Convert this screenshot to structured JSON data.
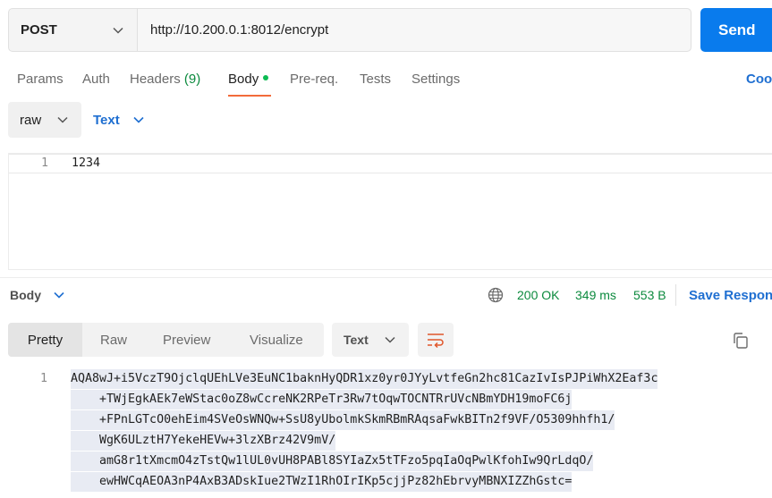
{
  "request": {
    "method": "POST",
    "url": "http://10.200.0.1:8012/encrypt",
    "send_label": "Send"
  },
  "tabs": [
    {
      "label": "Params"
    },
    {
      "label": "Auth"
    },
    {
      "label": "Headers",
      "count": "(9)"
    },
    {
      "label": "Body",
      "active": true
    },
    {
      "label": "Pre-req."
    },
    {
      "label": "Tests"
    },
    {
      "label": "Settings"
    }
  ],
  "cookies_label": "Coo",
  "body_options": {
    "mode": "raw",
    "language": "Text"
  },
  "request_body": {
    "line_number": "1",
    "text": "1234"
  },
  "response": {
    "section_label": "Body",
    "status": "200 OK",
    "time": "349 ms",
    "size": "553 B",
    "save_label": "Save Respon",
    "view_tabs": [
      "Pretty",
      "Raw",
      "Preview",
      "Visualize"
    ],
    "format": "Text",
    "line_number": "1",
    "body_lines": [
      "AQA8wJ+i5VczT9OjclqUEhLVe3EuNC1baknHyQDR1xz0yr0JYyLvtfeGn2hc81CazIvIsPJPiWhX2Eaf3c",
      "    +TWjEgkAEk7eWStac0oZ8wCcreNK2RPeTr3Rw7tOqwTOCNTRrUVcNBmYDH19moFC6j",
      "    +FPnLGTcO0ehEim4SVeOsWNQw+SsU8yUbolmkSkmRBmRAqsaFwkBITn2f9VF/O5309hhfh1/",
      "    WgK6ULztH7YekeHEVw+3lzXBrz42V9mV/",
      "    amG8r1tXmcmO4zTstQw1lUL0vUH8PABl8SYIaZx5tTFzo5pqIaOqPwlKfohIw9QrLdqO/",
      "    ewHWCqAEOA3nP4AxB3ADskIue2TWzI1RhOIrIKp5cjjPz82hEbrvyMBNXIZZhGstc="
    ]
  },
  "colors": {
    "send": "#097bed",
    "accent_underline": "#f26b3a",
    "success": "#0c8a3e",
    "link": "#1f6fd1"
  },
  "icons": [
    "chevron-down-icon",
    "globe-icon",
    "wrap-lines-icon",
    "copy-icon"
  ]
}
